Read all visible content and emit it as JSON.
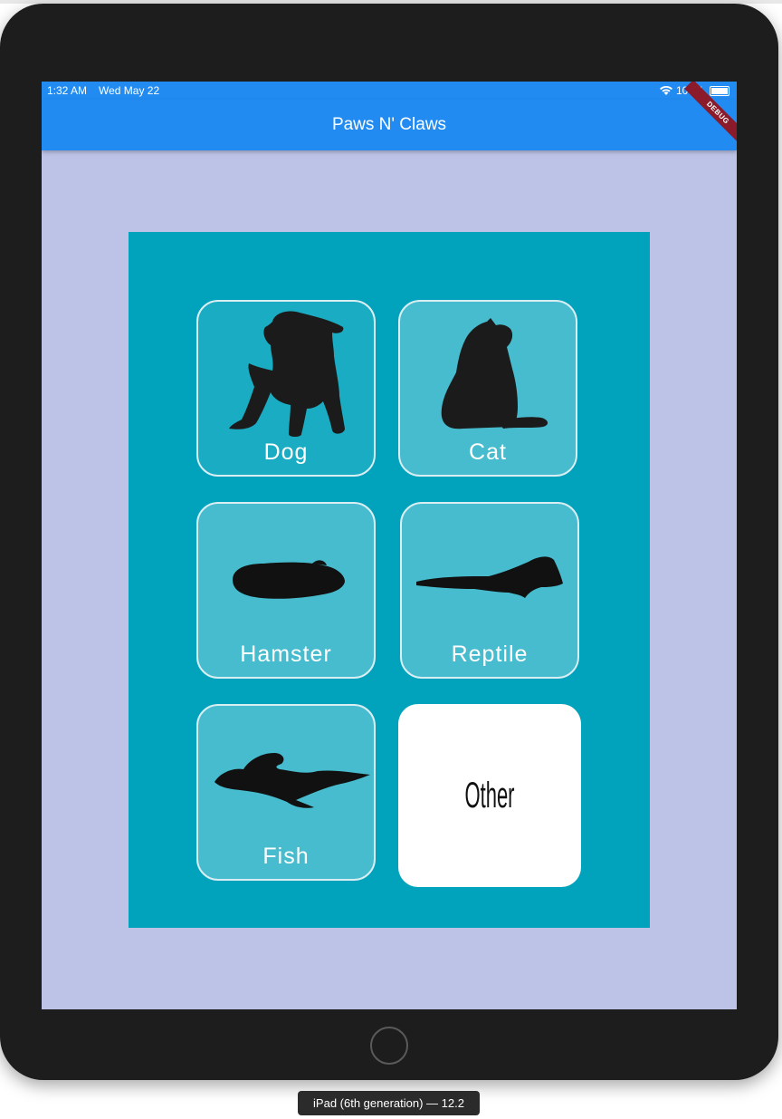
{
  "status": {
    "time": "1:32 AM",
    "date": "Wed May 22",
    "battery": "100%"
  },
  "app": {
    "title": "Paws N' Claws",
    "debug_banner": "DEBUG"
  },
  "tiles": [
    {
      "label": "Dog",
      "icon": "dog-silhouette-icon"
    },
    {
      "label": "Cat",
      "icon": "cat-silhouette-icon"
    },
    {
      "label": "Hamster",
      "icon": "hamster-silhouette-icon"
    },
    {
      "label": "Reptile",
      "icon": "reptile-silhouette-icon"
    },
    {
      "label": "Fish",
      "icon": "fish-silhouette-icon"
    },
    {
      "label": "Other",
      "icon": ""
    }
  ],
  "device": {
    "caption": "iPad (6th generation) — 12.2"
  },
  "colors": {
    "app_bar": "#218bf1",
    "background": "#bcc3e7",
    "panel": "#00a3bb",
    "device_frame": "#1d1d1e"
  }
}
